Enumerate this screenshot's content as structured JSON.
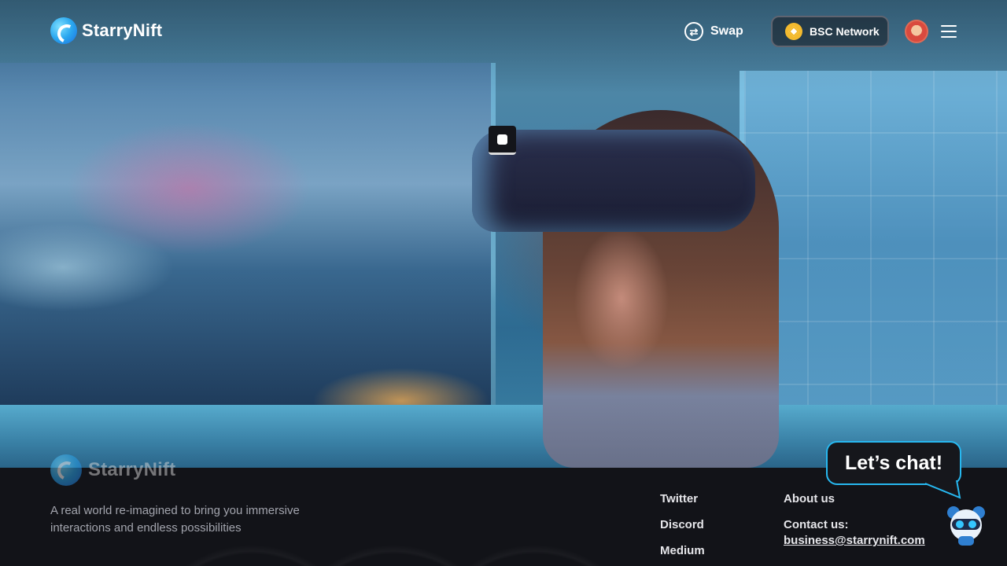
{
  "brand": {
    "name": "StarryNift"
  },
  "header": {
    "swap_label": "Swap",
    "network_label": "BSC Network"
  },
  "footer": {
    "brand_name": "StarryNift",
    "tagline": "A real world re-imagined to bring you immersive interactions and endless possibilities",
    "social_links": [
      "Twitter",
      "Discord",
      "Medium"
    ],
    "about_label": "About us",
    "contact_label": "Contact us:",
    "contact_email": "business@starrynift.com"
  },
  "chat": {
    "label": "Let’s chat!"
  },
  "colors": {
    "accent": "#27b8f0",
    "footer_bg": "#121318",
    "bnb": "#f3ba2f"
  },
  "icons": {
    "logo": "starrynift-logo-icon",
    "swap": "swap-icon",
    "network": "bnb-icon",
    "menu": "hamburger-menu-icon",
    "video": "play-pause-icon",
    "chat_bot": "robot-panda-icon"
  }
}
